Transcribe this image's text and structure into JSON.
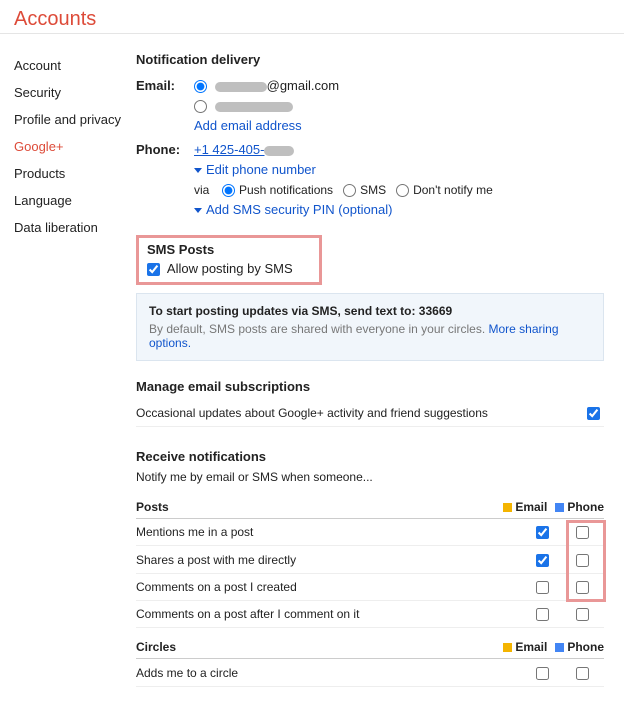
{
  "header": {
    "title": "Accounts"
  },
  "sidebar": {
    "items": [
      {
        "label": "Account"
      },
      {
        "label": "Security"
      },
      {
        "label": "Profile and privacy"
      },
      {
        "label": "Google+"
      },
      {
        "label": "Products"
      },
      {
        "label": "Language"
      },
      {
        "label": "Data liberation"
      }
    ]
  },
  "delivery": {
    "heading": "Notification delivery",
    "email_label": "Email:",
    "email_suffix": "@gmail.com",
    "add_email": "Add email address",
    "phone_label": "Phone:",
    "phone_value": "+1 425-405-",
    "edit_phone": "Edit phone number",
    "via_label": "via",
    "push": "Push notifications",
    "sms": "SMS",
    "dont": "Don't notify me",
    "add_pin": "Add SMS security PIN (optional)"
  },
  "smsposts": {
    "heading": "SMS Posts",
    "allow": "Allow posting by SMS"
  },
  "infobox": {
    "line1": "To start posting updates via SMS, send text to: 33669",
    "desc": "By default, SMS posts are shared with everyone in your circles. ",
    "more": "More sharing options."
  },
  "subs": {
    "heading": "Manage email subscriptions",
    "item": "Occasional updates about Google+ activity and friend suggestions"
  },
  "notify": {
    "heading": "Receive notifications",
    "sub": "Notify me by email or SMS when someone...",
    "col_email": "Email",
    "col_phone": "Phone",
    "posts_label": "Posts",
    "circles_label": "Circles",
    "rows_posts": [
      {
        "label": "Mentions me in a post",
        "email": true,
        "phone": false
      },
      {
        "label": "Shares a post with me directly",
        "email": true,
        "phone": false
      },
      {
        "label": "Comments on a post I created",
        "email": false,
        "phone": false
      },
      {
        "label": "Comments on a post after I comment on it",
        "email": false,
        "phone": false
      }
    ],
    "rows_circles": [
      {
        "label": "Adds me to a circle",
        "email": false,
        "phone": false
      }
    ]
  }
}
